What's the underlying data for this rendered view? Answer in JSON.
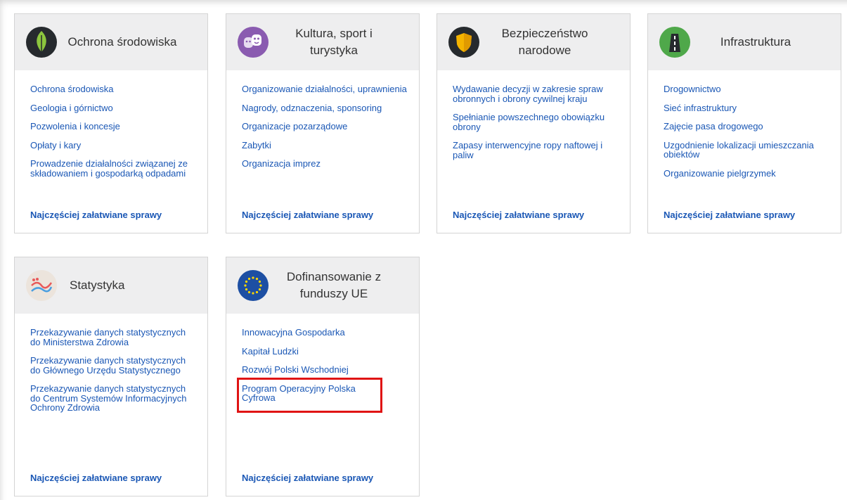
{
  "more_label": "Najczęściej załatwiane sprawy",
  "tiles": [
    {
      "title": "Ochrona środowiska",
      "icon": "leaf-icon",
      "links": [
        "Ochrona środowiska",
        "Geologia i górnictwo",
        "Pozwolenia i koncesje",
        "Opłaty i kary",
        "Prowadzenie działalności związanej ze składowaniem i gospodarką odpadami"
      ]
    },
    {
      "title": "Kultura, sport i turystyka",
      "icon": "theater-masks-icon",
      "links": [
        "Organizowanie działalności, uprawnienia",
        "Nagrody, odznaczenia, sponsoring",
        "Organizacje pozarządowe",
        "Zabytki",
        "Organizacja imprez"
      ]
    },
    {
      "title": "Bezpieczeństwo narodowe",
      "icon": "shield-icon",
      "links": [
        "Wydawanie decyzji w zakresie spraw obronnych i obrony cywilnej kraju",
        "Spełnianie powszechnego obowiązku obrony",
        "Zapasy interwencyjne ropy naftowej i paliw"
      ]
    },
    {
      "title": "Infrastruktura",
      "icon": "road-icon",
      "links": [
        "Drogownictwo",
        "Sieć infrastruktury",
        "Zajęcie pasa drogowego",
        "Uzgodnienie lokalizacji umieszczania obiektów",
        "Organizowanie pielgrzymek"
      ]
    },
    {
      "title": "Statystyka",
      "icon": "statistics-chart-icon",
      "links": [
        "Przekazywanie danych statystycznych do Ministerstwa Zdrowia",
        "Przekazywanie danych statystycznych do Głównego Urzędu Statystycznego",
        "Przekazywanie danych statystycznych do Centrum Systemów Informacyjnych Ochrony Zdrowia"
      ]
    },
    {
      "title": "Dofinansowanie z funduszy UE",
      "icon": "eu-flag-icon",
      "links": [
        "Innowacyjna Gospodarka",
        "Kapitał Ludzki",
        "Rozwój Polski Wschodniej",
        "Program Operacyjny Polska Cyfrowa"
      ]
    }
  ]
}
